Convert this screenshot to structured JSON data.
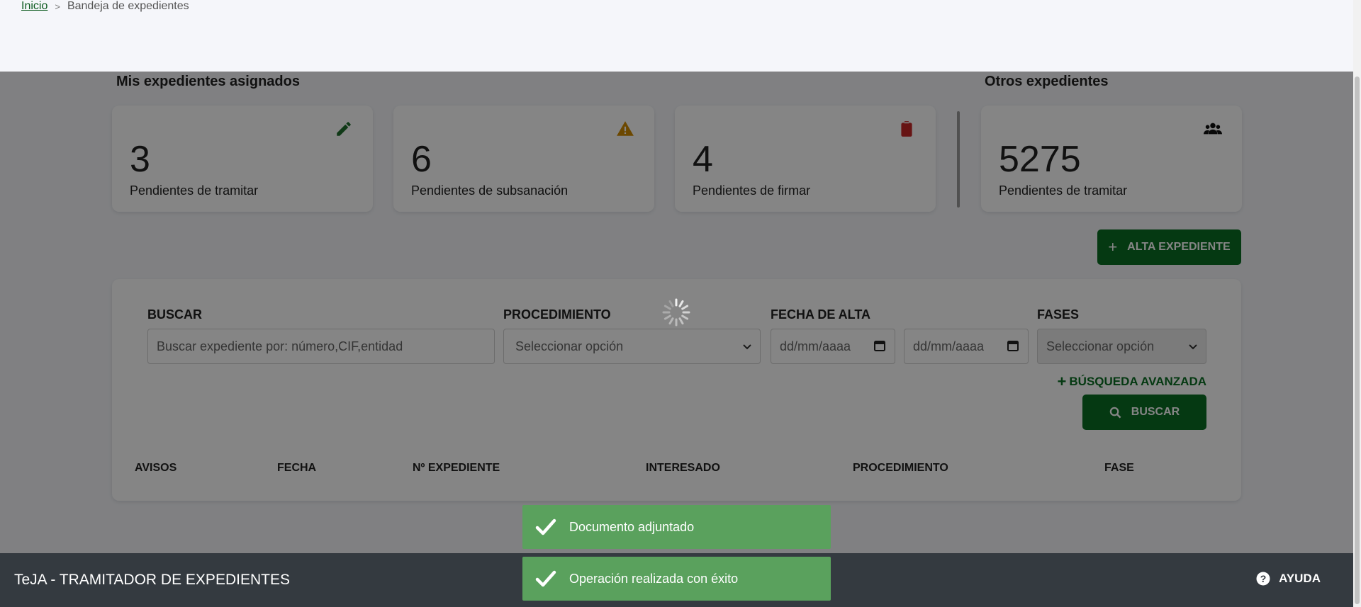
{
  "breadcrumb": {
    "home": "Inicio",
    "separator": ">",
    "current": "Bandeja de expedientes"
  },
  "sections": {
    "mine_title": "Mis expedientes asignados",
    "others_title": "Otros expedientes"
  },
  "cards": [
    {
      "value": "3",
      "label": "Pendientes de tramitar",
      "icon": "pencil-icon",
      "icon_color": "#1f6e2c"
    },
    {
      "value": "6",
      "label": "Pendientes de subsanación",
      "icon": "warning-icon",
      "icon_color": "#d08a00"
    },
    {
      "value": "4",
      "label": "Pendientes de firmar",
      "icon": "clipboard-icon",
      "icon_color": "#c62828"
    },
    {
      "value": "5275",
      "label": "Pendientes de tramitar",
      "icon": "users-icon",
      "icon_color": "#111111"
    }
  ],
  "actions": {
    "alta_label": "ALTA EXPEDIENTE"
  },
  "search": {
    "buscar_label": "BUSCAR",
    "buscar_placeholder": "Buscar expediente por: número,CIF,entidad",
    "procedimiento_label": "PROCEDIMIENTO",
    "procedimiento_value": "Seleccionar opción",
    "fecha_label": "FECHA DE ALTA",
    "fecha_from": "dd/mm/aaaa",
    "fecha_to": "dd/mm/aaaa",
    "fases_label": "FASES",
    "fases_value": "Seleccionar opción",
    "advanced_label": "BÚSQUEDA AVANZADA",
    "submit_label": "BUSCAR"
  },
  "table": {
    "headers": [
      "AVISOS",
      "FECHA",
      "Nº EXPEDIENTE",
      "INTERESADO",
      "PROCEDIMIENTO",
      "FASE"
    ]
  },
  "footer": {
    "app_title": "TeJA - TRAMITADOR DE EXPEDIENTES",
    "help_label": "AYUDA"
  },
  "toasts": [
    {
      "message": "Documento adjuntado"
    },
    {
      "message": "Operación realizada con éxito"
    }
  ],
  "colors": {
    "primary_green": "#0b6e24",
    "toast_green": "#5aa15d",
    "footer": "#343a40"
  }
}
